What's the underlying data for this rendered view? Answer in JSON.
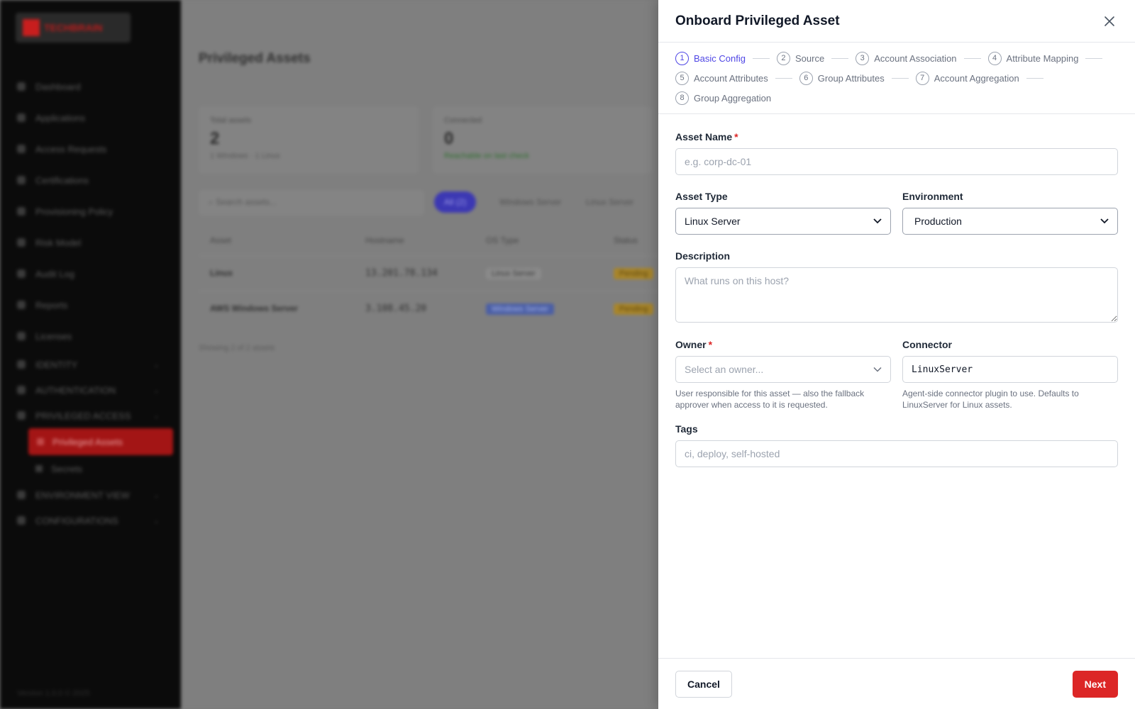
{
  "background": {
    "logo_text": "TECHBRAIN",
    "nav": [
      {
        "label": "Dashboard"
      },
      {
        "label": "Applications"
      },
      {
        "label": "Access Requests"
      },
      {
        "label": "Certifications"
      },
      {
        "label": "Provisioning Policy"
      },
      {
        "label": "Risk Model"
      },
      {
        "label": "Audit Log"
      },
      {
        "label": "Reports"
      },
      {
        "label": "Licenses"
      },
      {
        "label": "IDENTITY"
      },
      {
        "label": "AUTHENTICATION"
      },
      {
        "label": "PRIVILEGED ACCESS"
      }
    ],
    "nav_sub": [
      {
        "label": "Privileged Assets"
      },
      {
        "label": "Secrets"
      }
    ],
    "nav_bottom": [
      {
        "label": "ENVIRONMENT VIEW"
      },
      {
        "label": "CONFIGURATIONS"
      }
    ],
    "footer_text": "Version 1.0.0 © 2025",
    "page_title": "Privileged Assets",
    "stats": [
      {
        "label": "Total assets",
        "value": "2",
        "sub": "1 Windows · 1 Linux"
      },
      {
        "label": "Connected",
        "value": "0",
        "sub": "Reachable on last check"
      }
    ],
    "search_placeholder": "Search assets...",
    "chips": [
      "All (2)",
      "Windows Server",
      "Linux Server"
    ],
    "table": {
      "headers": [
        "Asset",
        "Hostname",
        "OS Type",
        "Status"
      ],
      "rows": [
        {
          "asset": "Linux",
          "host": "13.201.78.134",
          "os": "Linux Server",
          "status": "Pending"
        },
        {
          "asset": "AWS Windows Server",
          "host": "3.108.45.20",
          "os": "Windows Server",
          "status": "Pending"
        }
      ]
    },
    "footnote": "Showing 2 of 2 assets"
  },
  "drawer": {
    "title": "Onboard Privileged Asset",
    "steps": [
      {
        "num": "1",
        "label": "Basic Config"
      },
      {
        "num": "2",
        "label": "Source"
      },
      {
        "num": "3",
        "label": "Account Association"
      },
      {
        "num": "4",
        "label": "Attribute Mapping"
      },
      {
        "num": "5",
        "label": "Account Attributes"
      },
      {
        "num": "6",
        "label": "Group Attributes"
      },
      {
        "num": "7",
        "label": "Account Aggregation"
      },
      {
        "num": "8",
        "label": "Group Aggregation"
      }
    ],
    "form": {
      "asset_name": {
        "label": "Asset Name",
        "placeholder": "e.g. corp-dc-01",
        "value": ""
      },
      "asset_type": {
        "label": "Asset Type",
        "value": "Linux Server"
      },
      "environment": {
        "label": "Environment",
        "value": "Production"
      },
      "description": {
        "label": "Description",
        "placeholder": "What runs on this host?"
      },
      "owner": {
        "label": "Owner",
        "placeholder": "Select an owner...",
        "help": "User responsible for this asset — also the fallback approver when access to it is requested."
      },
      "connector": {
        "label": "Connector",
        "value": "LinuxServer",
        "help": "Agent-side connector plugin to use. Defaults to LinuxServer for Linux assets."
      },
      "tags": {
        "label": "Tags",
        "placeholder": "ci, deploy, self-hosted"
      },
      "required_mark": "*"
    },
    "footer": {
      "cancel": "Cancel",
      "next": "Next"
    }
  },
  "colors": {
    "accent": "#4f46e5",
    "primary": "#dc2626"
  },
  "icons": {
    "close": "close-icon",
    "chevron": "chevron-down-icon"
  }
}
